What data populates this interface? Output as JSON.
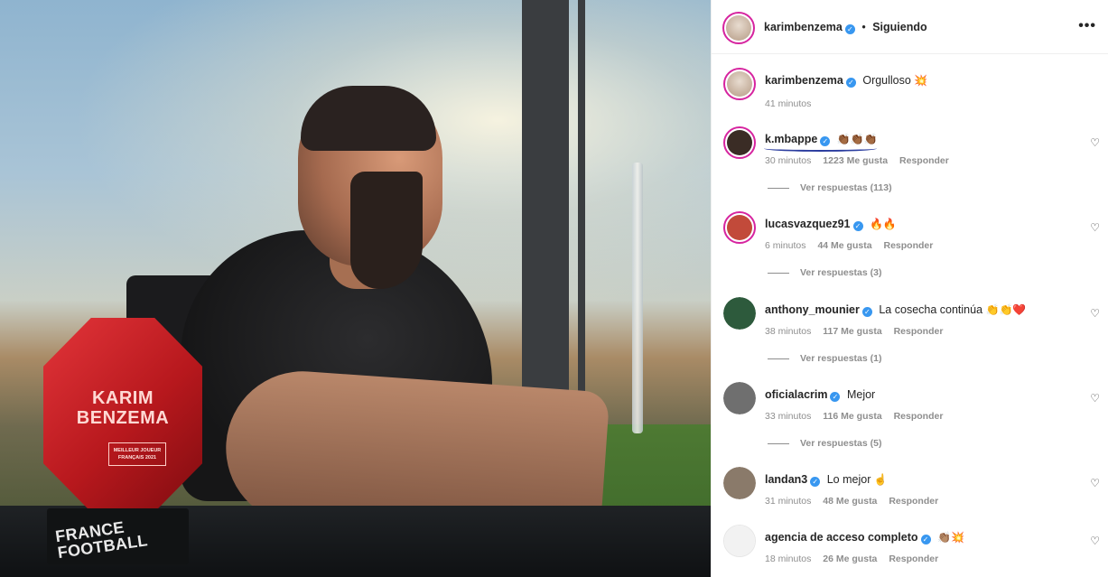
{
  "post": {
    "photo": {
      "trophy_name": "KARIM BENZEMA",
      "trophy_plate": "MEILLEUR JOUEUR FRANÇAIS 2021",
      "base_brand": "FRANCE FOOTBALL"
    }
  },
  "header": {
    "username": "karimbenzema",
    "separator": "•",
    "follow_status": "Siguiendo",
    "more_icon": "•••"
  },
  "caption": {
    "username": "karimbenzema",
    "text": "Orgulloso",
    "emoji": "💥",
    "time": "41 minutos"
  },
  "comments": [
    {
      "username": "k.mbappe",
      "text": "",
      "emoji": "👏🏾👏🏾👏🏾",
      "time": "30 minutos",
      "likes": "1223 Me gusta",
      "reply": "Responder",
      "replies": "Ver respuestas (113)",
      "avatar_color": "#3a2c25"
    },
    {
      "username": "lucasvazquez91",
      "text": "",
      "emoji": "🔥🔥",
      "time": "6 minutos",
      "likes": "44 Me gusta",
      "reply": "Responder",
      "replies": "Ver respuestas (3)",
      "avatar_color": "#c24a3a"
    },
    {
      "username": "anthony_mounier",
      "text": "La cosecha continúa",
      "emoji": "👏👏❤️",
      "time": "38 minutos",
      "likes": "117 Me gusta",
      "reply": "Responder",
      "replies": "Ver respuestas (1)",
      "avatar_color": "#2d5a3c"
    },
    {
      "username": "oficialacrim",
      "text": "Mejor",
      "emoji": "",
      "time": "33 minutos",
      "likes": "116 Me gusta",
      "reply": "Responder",
      "replies": "Ver respuestas (5)",
      "avatar_color": "#6f6f6f"
    },
    {
      "username": "landan3",
      "text": "Lo mejor",
      "emoji": "☝️",
      "time": "31 minutos",
      "likes": "48 Me gusta",
      "reply": "Responder",
      "replies": "",
      "avatar_color": "#8a7a6a"
    },
    {
      "username": "agencia de acceso completo",
      "text": "",
      "emoji": "👏🏽💥",
      "time": "18 minutos",
      "likes": "26 Me gusta",
      "reply": "Responder",
      "replies": "",
      "avatar_color": "#f2f2f2"
    }
  ],
  "icons": {
    "heart": "heart-icon",
    "verified": "verified-badge-icon",
    "more": "more-options-icon"
  },
  "colors": {
    "verified": "#3897f0",
    "story_ring": "#d6249f",
    "meta_text": "#8e8e8e",
    "trophy_red": "#c8171c"
  }
}
